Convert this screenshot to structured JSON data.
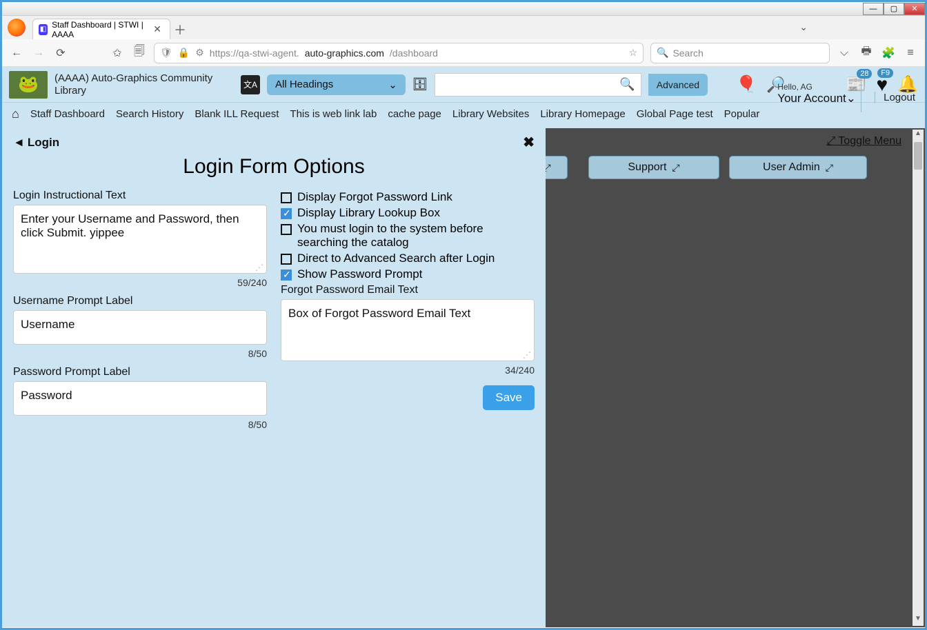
{
  "window": {
    "tab_title": "Staff Dashboard | STWI | AAAA"
  },
  "browser": {
    "url_prefix": "https://qa-stwi-agent.",
    "url_domain": "auto-graphics.com",
    "url_path": "/dashboard",
    "search_placeholder": "Search"
  },
  "site": {
    "title": "(AAAA) Auto-Graphics Community Library",
    "headings_label": "All Headings",
    "advanced_label": "Advanced",
    "badge_news": "28",
    "badge_fav": "F9",
    "hello": "Hello, AG",
    "account": "Your Account",
    "logout": "Logout"
  },
  "nav": {
    "items": [
      "Staff Dashboard",
      "Search History",
      "Blank ILL Request",
      "This is web link lab",
      "cache page",
      "Library Websites",
      "Library Homepage",
      "Global Page test",
      "Popular"
    ]
  },
  "dash": {
    "toggle": "Toggle Menu",
    "support": "Support",
    "useradmin": "User Admin"
  },
  "modal": {
    "back_label": "Login",
    "title": "Login Form Options",
    "instr_label": "Login Instructional Text",
    "instr_value": "Enter your Username and Password, then click Submit. yippee",
    "instr_counter": "59/240",
    "user_label": "Username Prompt Label",
    "user_value": "Username",
    "user_counter": "8/50",
    "pass_label": "Password Prompt Label",
    "pass_value": "Password",
    "pass_counter": "8/50",
    "chk_forgot": "Display Forgot Password Link",
    "chk_lookup": "Display Library Lookup Box",
    "chk_mustlogin": "You must login to the system before searching the catalog",
    "chk_direct": "Direct to Advanced Search after Login",
    "chk_showpw": "Show Password Prompt",
    "forgot_email_label": "Forgot Password Email Text",
    "forgot_email_value": "Box of Forgot Password Email Text",
    "forgot_email_counter": "34/240",
    "save": "Save"
  }
}
